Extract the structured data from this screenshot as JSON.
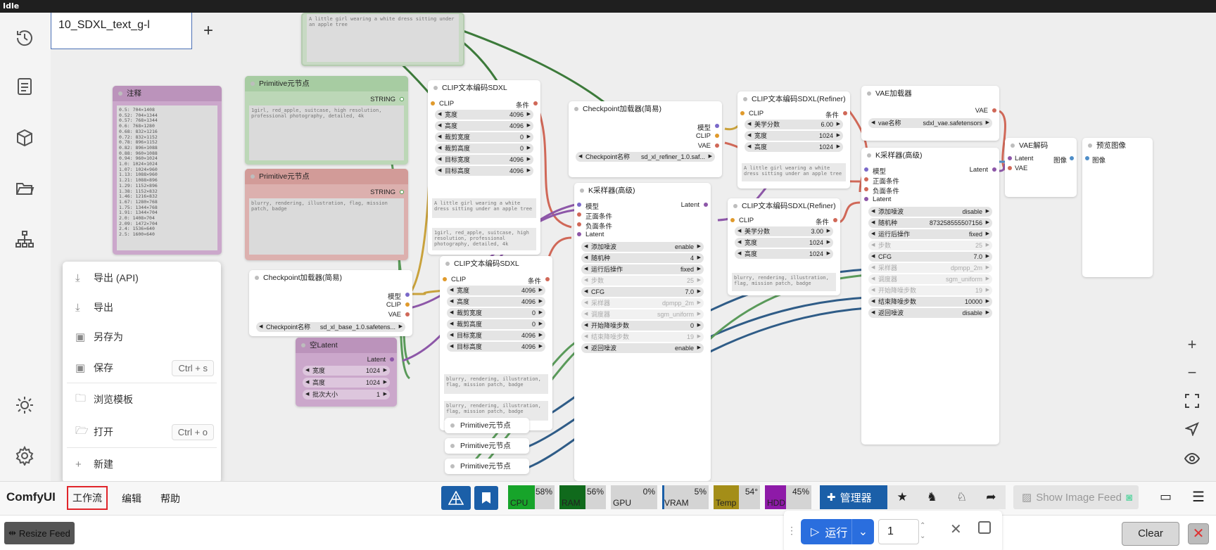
{
  "app": {
    "status": "Idle",
    "brand": "ComfyUI"
  },
  "tab": {
    "title": "10_SDXL_text_g-l"
  },
  "menubar": {
    "workflow": "工作流",
    "edit": "编辑",
    "help": "帮助"
  },
  "menu": [
    {
      "label": "导出 (API)",
      "icon": "download-icon"
    },
    {
      "label": "导出",
      "icon": "download-icon"
    },
    {
      "label": "另存为",
      "icon": "save-icon"
    },
    {
      "label": "保存",
      "icon": "save-icon",
      "shortcut": "Ctrl + s"
    },
    {
      "label": "浏览模板",
      "icon": "folder-icon"
    },
    {
      "label": "打开",
      "icon": "folder-open-icon",
      "shortcut": "Ctrl + o"
    },
    {
      "label": "新建",
      "icon": "plus-icon"
    }
  ],
  "monitor": {
    "cpu": "CPU",
    "cpu_pct": "58%",
    "ram": "RAM",
    "ram_pct": "56%",
    "gpu": "GPU",
    "gpu_pct": "0%",
    "vram": "VRAM",
    "vram_pct": "5%",
    "temp": "Temp",
    "temp_val": "54°",
    "hdd": "HDD",
    "hdd_pct": "45%"
  },
  "toolbar": {
    "manager": "管理器",
    "show_feed": "Show Image Feed",
    "resize_feed": "Resize Feed",
    "run": "运行",
    "batch": "1",
    "clear": "Clear"
  },
  "nodes": {
    "note": {
      "title": "注释",
      "text": [
        "0.5:   704×1408",
        "0.52:  704×1344",
        "0.57:  768×1344",
        "0.6:   768×1280",
        "0.68:  832×1216",
        "0.72:  832×1152",
        "0.78:  896×1152",
        "0.82:  896×1088",
        "0.88:  960×1088",
        "0.94:  960×1024",
        "1.0:   1024×1024",
        "1.07:  1024×960",
        "1.13:  1088×960",
        "1.21:  1088×896",
        "1.29:  1152×896",
        "1.38:  1152×832",
        "1.46:  1216×832",
        "1.67:  1280×768",
        "1.75:  1344×768",
        "1.91:  1344×704",
        "2.0:   1408×704",
        "2.09:  1472×704",
        "2.4:   1536×640",
        "2.5:   1600×640"
      ]
    },
    "top_text": "A little girl wearing a white dress sitting under an apple tree",
    "prim1": {
      "title": "Primitive元节点",
      "out": "STRING",
      "text": "1girl, red_apple, suitcase, high resolution, professional photography, detailed, 4k"
    },
    "prim2": {
      "title": "Primitive元节点",
      "out": "STRING",
      "text": "blurry, rendering, illustration, flag, mission patch, badge"
    },
    "ckpt_base": {
      "title": "Checkpoint加载器(简易)",
      "o1": "模型",
      "o2": "CLIP",
      "o3": "VAE",
      "widget": "Checkpoint名称",
      "value": "sd_xl_base_1.0.safetens..."
    },
    "latent": {
      "title": "空Latent",
      "out": "Latent",
      "w_l": "宽度",
      "w_v": "1024",
      "h_l": "高度",
      "h_v": "1024",
      "b_l": "批次大小",
      "b_v": "1"
    },
    "clip1": {
      "title": "CLIP文本编码SDXL",
      "in": "CLIP",
      "out": "条件",
      "ws": [
        [
          "宽度",
          "4096"
        ],
        [
          "高度",
          "4096"
        ],
        [
          "裁剪宽度",
          "0"
        ],
        [
          "裁剪高度",
          "0"
        ],
        [
          "目标宽度",
          "4096"
        ],
        [
          "目标高度",
          "4096"
        ]
      ],
      "t1": "A little girl wearing a white dress sitting under an apple tree",
      "t2": "1girl, red_apple, suitcase, high resolution, professional photography, detailed, 4k"
    },
    "clip2": {
      "title": "CLIP文本编码SDXL",
      "in": "CLIP",
      "out": "条件",
      "ws": [
        [
          "宽度",
          "4096"
        ],
        [
          "高度",
          "4096"
        ],
        [
          "裁剪宽度",
          "0"
        ],
        [
          "裁剪高度",
          "0"
        ],
        [
          "目标宽度",
          "4096"
        ],
        [
          "目标高度",
          "4096"
        ]
      ],
      "t1": "blurry, rendering, illustration, flag, mission patch, badge",
      "t2": "blurry, rendering, illustration, flag, mission patch, badge"
    },
    "prims": [
      "Primitive元节点",
      "Primitive元节点",
      "Primitive元节点"
    ],
    "ckpt_ref": {
      "title": "Checkpoint加载器(简易)",
      "o1": "模型",
      "o2": "CLIP",
      "o3": "VAE",
      "widget": "Checkpoint名称",
      "value": "sd_xl_refiner_1.0.saf..."
    },
    "ksampler1": {
      "title": "K采样器(高级)",
      "ins": [
        "模型",
        "正面条件",
        "负面条件",
        "Latent"
      ],
      "out": "Latent",
      "ws": [
        [
          "添加噪波",
          "enable"
        ],
        [
          "随机种",
          "4"
        ],
        [
          "运行后操作",
          "fixed"
        ],
        [
          "步数",
          "25"
        ],
        [
          "CFG",
          "7.0"
        ],
        [
          "采样器",
          "dpmpp_2m"
        ],
        [
          "调度器",
          "sgm_uniform"
        ],
        [
          "开始降噪步数",
          "0"
        ],
        [
          "结束降噪步数",
          "19"
        ],
        [
          "返回噪波",
          "enable"
        ]
      ]
    },
    "refiner1": {
      "title": "CLIP文本编码SDXL(Refiner)",
      "in": "CLIP",
      "out": "条件",
      "ws": [
        [
          "美学分数",
          "6.00"
        ],
        [
          "宽度",
          "1024"
        ],
        [
          "高度",
          "1024"
        ]
      ],
      "text": "A little girl wearing a white dress sitting under an apple tree"
    },
    "refiner2": {
      "title": "CLIP文本编码SDXL(Refiner)",
      "in": "CLIP",
      "out": "条件",
      "ws": [
        [
          "美学分数",
          "3.00"
        ],
        [
          "宽度",
          "1024"
        ],
        [
          "高度",
          "1024"
        ]
      ],
      "text": "blurry, rendering, illustration, flag, mission patch, badge"
    },
    "vaeload": {
      "title": "VAE加载器",
      "out": "VAE",
      "widget": "vae名称",
      "value": "sdxl_vae.safetensors"
    },
    "ksampler2": {
      "title": "K采样器(高级)",
      "ins": [
        "模型",
        "正面条件",
        "负面条件",
        "Latent"
      ],
      "out": "Latent",
      "ws": [
        [
          "添加噪波",
          "disable"
        ],
        [
          "随机种",
          "873258555507156"
        ],
        [
          "运行后操作",
          "fixed"
        ],
        [
          "步数",
          "25"
        ],
        [
          "CFG",
          "7.0"
        ],
        [
          "采样器",
          "dpmpp_2m"
        ],
        [
          "调度器",
          "sgm_uniform"
        ],
        [
          "开始降噪步数",
          "19"
        ],
        [
          "结束降噪步数",
          "10000"
        ],
        [
          "返回噪波",
          "disable"
        ]
      ]
    },
    "vaedecode": {
      "title": "VAE解码",
      "i1": "Latent",
      "i2": "VAE",
      "out": "图像"
    },
    "preview": {
      "title": "预览图像",
      "in": "图像"
    }
  }
}
